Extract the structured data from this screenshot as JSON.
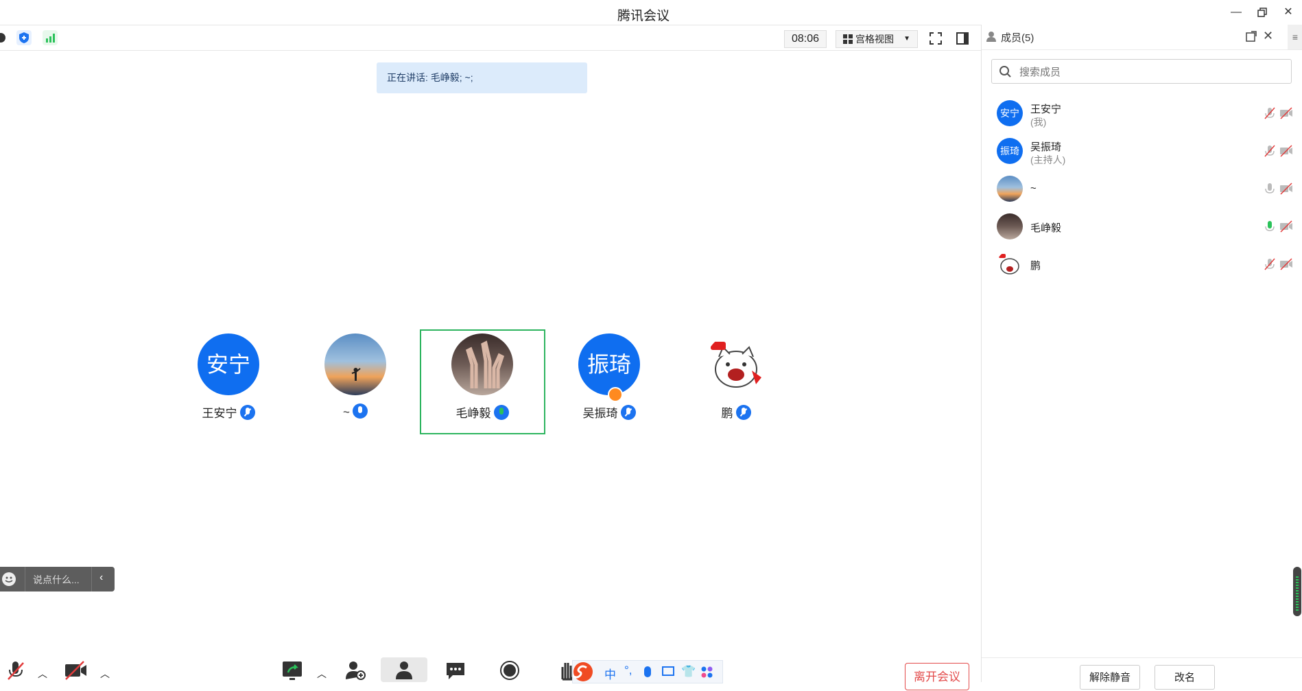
{
  "window": {
    "title": "腾讯会议"
  },
  "toolbar": {
    "time": "08:06",
    "view_mode": "宫格视图"
  },
  "speaking_banner": "正在讲话: 毛峥毅; ~;",
  "participants": [
    {
      "name": "王安宁",
      "avatar_text": "安宁",
      "mic": "muted"
    },
    {
      "name": "~",
      "avatar_text": "",
      "mic": "on"
    },
    {
      "name": "毛峥毅",
      "avatar_text": "",
      "mic": "speaking"
    },
    {
      "name": "吴振琦",
      "avatar_text": "振琦",
      "mic": "muted",
      "host": true
    },
    {
      "name": "鹏",
      "avatar_text": "",
      "mic": "muted"
    }
  ],
  "chat": {
    "placeholder": "说点什么..."
  },
  "bottom": {
    "leave_label": "离开会议"
  },
  "members_panel": {
    "title": "成员(5)",
    "search_placeholder": "搜索成员",
    "members": [
      {
        "name": "王安宁",
        "role": "(我)",
        "avatar_text": "安宁"
      },
      {
        "name": "吴振琦",
        "role": "(主持人)",
        "avatar_text": "振琦"
      },
      {
        "name": "~",
        "role": "",
        "avatar_text": ""
      },
      {
        "name": "毛峥毅",
        "role": "",
        "avatar_text": ""
      },
      {
        "name": "鹏",
        "role": "",
        "avatar_text": ""
      }
    ],
    "buttons": {
      "unmute_all": "解除静音",
      "rename": "改名"
    }
  },
  "colors": {
    "accent": "#0f6ef0",
    "speaking_border": "#2cb45e",
    "leave": "#e34b4b"
  }
}
